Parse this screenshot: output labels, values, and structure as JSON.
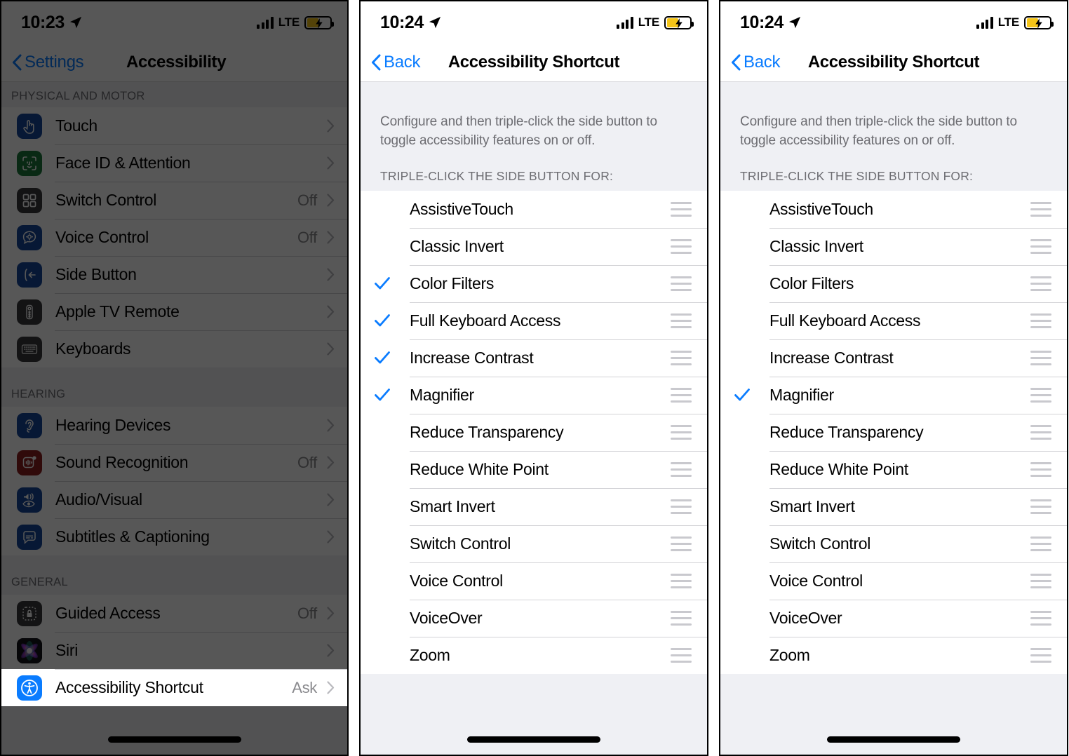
{
  "panels": [
    {
      "id": "accessibility-settings",
      "dimmed": true,
      "status": {
        "time": "10:23",
        "carrier": "LTE",
        "location_icon": "location-arrow-icon",
        "signal_icon": "cellular-bars-icon",
        "battery_icon": "battery-charging-icon"
      },
      "nav": {
        "back_label": "Settings",
        "title": "Accessibility"
      },
      "sections": [
        {
          "header": "PHYSICAL AND MOTOR",
          "rows": [
            {
              "label": "Touch",
              "value": "",
              "icon": "touch-icon",
              "icon_color": "#16489b",
              "chevron": true
            },
            {
              "label": "Face ID & Attention",
              "value": "",
              "icon": "face-id-icon",
              "icon_color": "#1d7a3c",
              "chevron": true
            },
            {
              "label": "Switch Control",
              "value": "Off",
              "icon": "switch-control-icon",
              "icon_color": "#3a3a3c",
              "chevron": true
            },
            {
              "label": "Voice Control",
              "value": "Off",
              "icon": "voice-control-icon",
              "icon_color": "#16489b",
              "chevron": true
            },
            {
              "label": "Side Button",
              "value": "",
              "icon": "side-button-icon",
              "icon_color": "#16489b",
              "chevron": true
            },
            {
              "label": "Apple TV Remote",
              "value": "",
              "icon": "apple-tv-remote-icon",
              "icon_color": "#3a3a3c",
              "chevron": true
            },
            {
              "label": "Keyboards",
              "value": "",
              "icon": "keyboard-icon",
              "icon_color": "#3a3a3c",
              "chevron": true
            }
          ]
        },
        {
          "header": "HEARING",
          "rows": [
            {
              "label": "Hearing Devices",
              "value": "",
              "icon": "ear-icon",
              "icon_color": "#16489b",
              "chevron": true
            },
            {
              "label": "Sound Recognition",
              "value": "Off",
              "icon": "sound-recognition-icon",
              "icon_color": "#8e1f1f",
              "chevron": true
            },
            {
              "label": "Audio/Visual",
              "value": "",
              "icon": "audio-visual-icon",
              "icon_color": "#16489b",
              "chevron": true
            },
            {
              "label": "Subtitles & Captioning",
              "value": "",
              "icon": "subtitles-icon",
              "icon_color": "#16489b",
              "chevron": true
            }
          ]
        },
        {
          "header": "GENERAL",
          "rows": [
            {
              "label": "Guided Access",
              "value": "Off",
              "icon": "guided-access-icon",
              "icon_color": "#3a3a3c",
              "chevron": true
            },
            {
              "label": "Siri",
              "value": "",
              "icon": "siri-icon",
              "icon_color": "#1c1c1e",
              "chevron": true
            },
            {
              "label": "Accessibility Shortcut",
              "value": "Ask",
              "icon": "accessibility-icon",
              "icon_color": "#0a7cff",
              "chevron": true,
              "highlight": true
            }
          ]
        }
      ]
    },
    {
      "id": "accessibility-shortcut-before",
      "dimmed": false,
      "status": {
        "time": "10:24",
        "carrier": "LTE",
        "location_icon": "location-arrow-icon",
        "signal_icon": "cellular-bars-icon",
        "battery_icon": "battery-charging-icon"
      },
      "nav": {
        "back_label": "Back",
        "title": "Accessibility Shortcut"
      },
      "intro": "Configure and then triple-click the side button to toggle accessibility features on or off.",
      "caption": "TRIPLE-CLICK THE SIDE BUTTON FOR:",
      "items": [
        {
          "label": "AssistiveTouch",
          "checked": false
        },
        {
          "label": "Classic Invert",
          "checked": false
        },
        {
          "label": "Color Filters",
          "checked": true
        },
        {
          "label": "Full Keyboard Access",
          "checked": true
        },
        {
          "label": "Increase Contrast",
          "checked": true
        },
        {
          "label": "Magnifier",
          "checked": true
        },
        {
          "label": "Reduce Transparency",
          "checked": false
        },
        {
          "label": "Reduce White Point",
          "checked": false
        },
        {
          "label": "Smart Invert",
          "checked": false
        },
        {
          "label": "Switch Control",
          "checked": false
        },
        {
          "label": "Voice Control",
          "checked": false
        },
        {
          "label": "VoiceOver",
          "checked": false
        },
        {
          "label": "Zoom",
          "checked": false
        }
      ]
    },
    {
      "id": "accessibility-shortcut-after",
      "dimmed": false,
      "status": {
        "time": "10:24",
        "carrier": "LTE",
        "location_icon": "location-arrow-icon",
        "signal_icon": "cellular-bars-icon",
        "battery_icon": "battery-charging-icon"
      },
      "nav": {
        "back_label": "Back",
        "title": "Accessibility Shortcut"
      },
      "intro": "Configure and then triple-click the side button to toggle accessibility features on or off.",
      "caption": "TRIPLE-CLICK THE SIDE BUTTON FOR:",
      "items": [
        {
          "label": "AssistiveTouch",
          "checked": false
        },
        {
          "label": "Classic Invert",
          "checked": false
        },
        {
          "label": "Color Filters",
          "checked": false
        },
        {
          "label": "Full Keyboard Access",
          "checked": false
        },
        {
          "label": "Increase Contrast",
          "checked": false
        },
        {
          "label": "Magnifier",
          "checked": true
        },
        {
          "label": "Reduce Transparency",
          "checked": false
        },
        {
          "label": "Reduce White Point",
          "checked": false
        },
        {
          "label": "Smart Invert",
          "checked": false
        },
        {
          "label": "Switch Control",
          "checked": false
        },
        {
          "label": "Voice Control",
          "checked": false
        },
        {
          "label": "VoiceOver",
          "checked": false
        },
        {
          "label": "Zoom",
          "checked": false
        }
      ]
    }
  ],
  "colors": {
    "accent_blue": "#0a7cff",
    "checkmark_blue": "#0a7cff",
    "battery_yellow": "#f5c518",
    "group_bg": "#eff0f4",
    "separator": "#d2d2d6",
    "secondary_text": "#6d6d72"
  }
}
